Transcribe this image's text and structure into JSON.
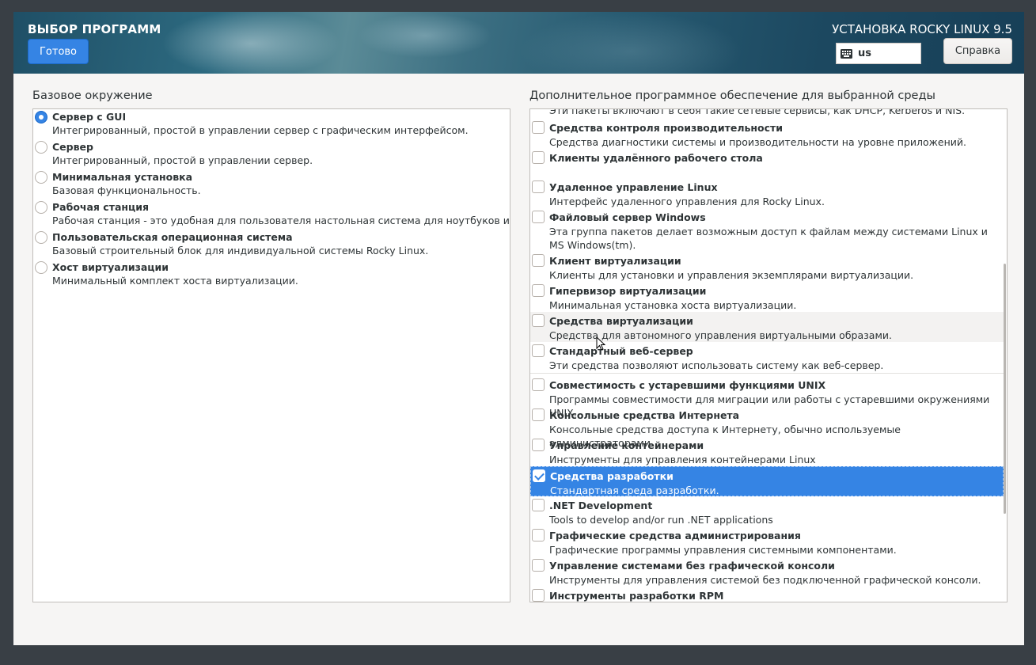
{
  "header": {
    "title": "ВЫБОР ПРОГРАММ",
    "done_label": "Готово",
    "product": "УСТАНОВКА ROCKY LINUX 9.5",
    "keyboard_icon": "keyboard-icon",
    "keyboard_layout": "us",
    "help_label": "Справка"
  },
  "base_env": {
    "label": "Базовое окружение",
    "items": [
      {
        "name": "Сервер с GUI",
        "desc": "Интегрированный, простой в управлении сервер с графическим интерфейсом.",
        "selected": true
      },
      {
        "name": "Сервер",
        "desc": "Интегрированный, простой в управлении сервер.",
        "selected": false
      },
      {
        "name": "Минимальная установка",
        "desc": "Базовая функциональность.",
        "selected": false
      },
      {
        "name": "Рабочая станция",
        "desc": "Рабочая станция - это удобная для пользователя настольная система для ноутбуков и ПК.",
        "selected": false
      },
      {
        "name": "Пользовательская операционная система",
        "desc": "Базовый строительный блок для индивидуальной системы Rocky Linux.",
        "selected": false
      },
      {
        "name": "Хост виртуализации",
        "desc": "Минимальный комплект хоста виртуализации.",
        "selected": false
      }
    ]
  },
  "addons": {
    "label": "Дополнительное программное обеспечение для выбранной среды",
    "partial_desc": "Эти пакеты включают в себя такие сетевые сервисы, как DHCP, Kerberos и NIS.",
    "items": [
      {
        "name": "Средства контроля производительности",
        "desc": "Средства диагностики системы и производительности на уровне приложений.",
        "checked": false
      },
      {
        "name": "Клиенты удалённого рабочего стола",
        "desc": "",
        "checked": false
      },
      {
        "name": "Удаленное управление Linux",
        "desc": "Интерфейс удаленного управления для Rocky Linux.",
        "checked": false
      },
      {
        "name": "Файловый сервер Windows",
        "desc": "Эта группа пакетов делает возможным доступ к файлам между системами Linux и MS Windows(tm).",
        "checked": false
      },
      {
        "name": "Клиент виртуализации",
        "desc": "Клиенты для установки и управления экземплярами виртуализации.",
        "checked": false
      },
      {
        "name": "Гипервизор виртуализации",
        "desc": "Минимальная установка хоста виртуализации.",
        "checked": false
      },
      {
        "name": "Средства виртуализации",
        "desc": "Средства для автономного управления виртуальными образами.",
        "checked": false
      },
      {
        "name": "Стандартный веб-сервер",
        "desc": "Эти средства позволяют использовать систему как веб-сервер.",
        "checked": false
      },
      {
        "name": "Совместимость с устаревшими функциями UNIX",
        "desc": "Программы совместимости для миграции или работы с устаревшими окружениями UNIX.",
        "checked": false
      },
      {
        "name": "Консольные средства Интернета",
        "desc": "Консольные средства доступа к Интернету, обычно используемые администраторами.",
        "checked": false
      },
      {
        "name": "Управление контейнерами",
        "desc": "Инструменты для управления контейнерами Linux",
        "checked": false
      },
      {
        "name": "Средства разработки",
        "desc": "Стандартная среда разработки.",
        "checked": true
      },
      {
        "name": ".NET Development",
        "desc": "Tools to develop and/or run .NET applications",
        "checked": false
      },
      {
        "name": "Графические средства администрирования",
        "desc": "Графические программы управления системными компонентами.",
        "checked": false
      },
      {
        "name": "Управление системами без графической консоли",
        "desc": "Инструменты для управления системой без подключенной графической консоли.",
        "checked": false
      },
      {
        "name": "Инструменты разработки RPM",
        "desc": "",
        "checked": false
      }
    ]
  }
}
